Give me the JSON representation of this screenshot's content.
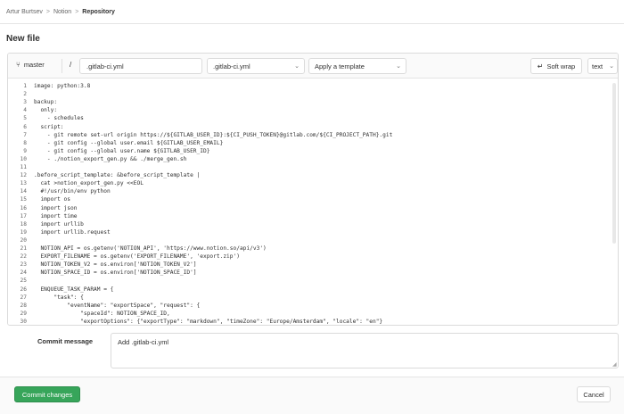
{
  "breadcrumb": [
    {
      "label": "Artur Burtsev"
    },
    {
      "label": "Notion"
    },
    {
      "label": "Repository"
    }
  ],
  "breadcrumb_separator": ">",
  "page_title": "New file",
  "toolbar": {
    "branch": "master",
    "branch_icon": "branch-icon",
    "path_separator": "/",
    "filename": ".gitlab-ci.yml",
    "file_type": ".gitlab-ci.yml",
    "template_placeholder": "Apply a template",
    "soft_wrap_label": "Soft wrap",
    "mode": "text"
  },
  "code_lines": [
    {
      "n": "1",
      "text": "image: python:3.8"
    },
    {
      "n": "2",
      "text": ""
    },
    {
      "n": "3",
      "text": "backup:"
    },
    {
      "n": "4",
      "text": "  only:"
    },
    {
      "n": "5",
      "text": "    - schedules"
    },
    {
      "n": "6",
      "text": "  script:"
    },
    {
      "n": "7",
      "text": "    - git remote set-url origin https://${GITLAB_USER_ID}:${CI_PUSH_TOKEN}@gitlab.com/${CI_PROJECT_PATH}.git"
    },
    {
      "n": "8",
      "text": "    - git config --global user.email ${GITLAB_USER_EMAIL}"
    },
    {
      "n": "9",
      "text": "    - git config --global user.name ${GITLAB_USER_ID}"
    },
    {
      "n": "10",
      "text": "    - ./notion_export_gen.py && ./merge_gen.sh"
    },
    {
      "n": "11",
      "text": ""
    },
    {
      "n": "12",
      "text": ".before_script_template: &before_script_template |"
    },
    {
      "n": "13",
      "text": "  cat >notion_export_gen.py <<EOL"
    },
    {
      "n": "14",
      "text": "  #!/usr/bin/env python"
    },
    {
      "n": "15",
      "text": "  import os"
    },
    {
      "n": "16",
      "text": "  import json"
    },
    {
      "n": "17",
      "text": "  import time"
    },
    {
      "n": "18",
      "text": "  import urllib"
    },
    {
      "n": "19",
      "text": "  import urllib.request"
    },
    {
      "n": "20",
      "text": ""
    },
    {
      "n": "21",
      "text": "  NOTION_API = os.getenv('NOTION_API', 'https://www.notion.so/api/v3')"
    },
    {
      "n": "22",
      "text": "  EXPORT_FILENAME = os.getenv('EXPORT_FILENAME', 'export.zip')"
    },
    {
      "n": "23",
      "text": "  NOTION_TOKEN_V2 = os.environ['NOTION_TOKEN_V2']"
    },
    {
      "n": "24",
      "text": "  NOTION_SPACE_ID = os.environ['NOTION_SPACE_ID']"
    },
    {
      "n": "25",
      "text": ""
    },
    {
      "n": "26",
      "text": "  ENQUEUE_TASK_PARAM = {"
    },
    {
      "n": "27",
      "text": "      \"task\": {"
    },
    {
      "n": "28",
      "text": "          \"eventName\": \"exportSpace\", \"request\": {"
    },
    {
      "n": "29",
      "text": "              \"spaceId\": NOTION_SPACE_ID,"
    },
    {
      "n": "30",
      "text": "              \"exportOptions\": {\"exportType\": \"markdown\", \"timeZone\": \"Europe/Amsterdam\", \"locale\": \"en\"}"
    },
    {
      "n": "31",
      "text": "          }"
    }
  ],
  "commit": {
    "label": "Commit message",
    "message": "Add .gitlab-ci.yml"
  },
  "footer": {
    "commit_button": "Commit changes",
    "cancel_button": "Cancel"
  },
  "colors": {
    "primary_green": "#37a55a",
    "border": "#dbdbdb",
    "text": "#303030"
  }
}
